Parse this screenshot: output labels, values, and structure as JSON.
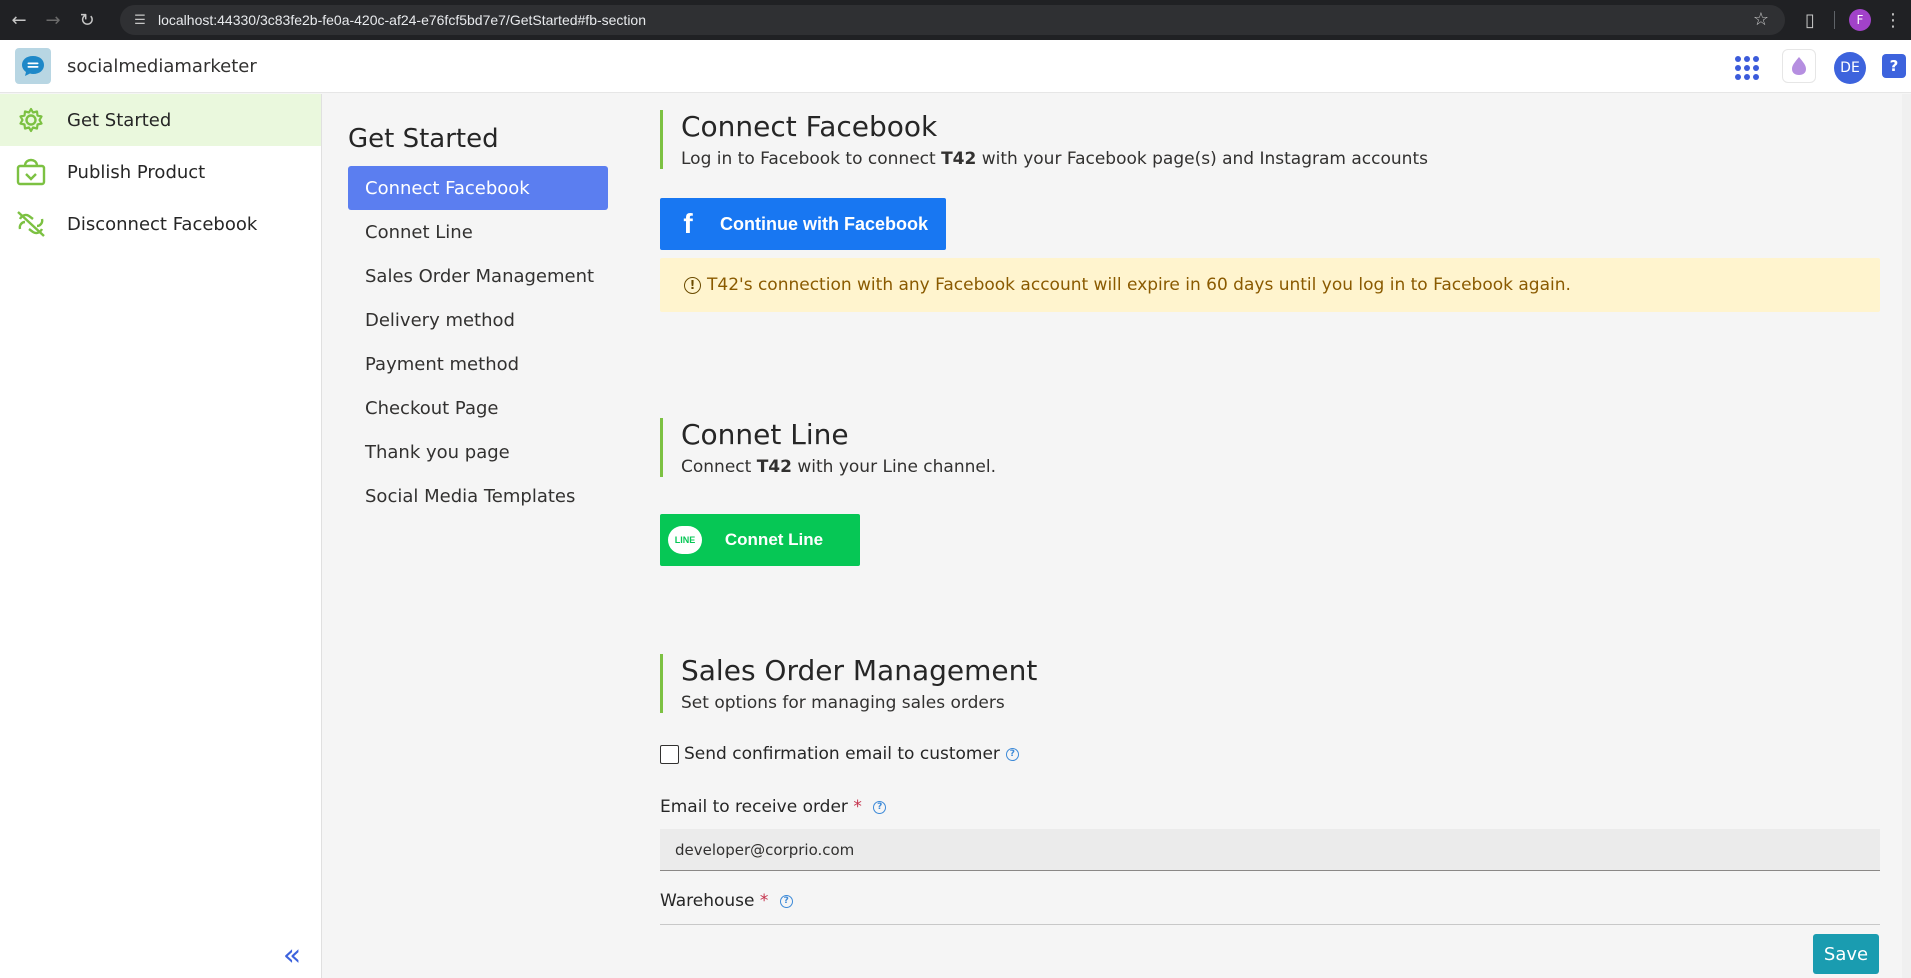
{
  "browser": {
    "url": "localhost:44330/3c83fe2b-fe0a-420c-af24-e76fcf5bd7e7/GetStarted#fb-section",
    "profile_initial": "F"
  },
  "app": {
    "name": "socialmediamarketer",
    "user_initials": "DE",
    "help_label": "?"
  },
  "leftnav": {
    "items": [
      {
        "label": "Get Started",
        "icon": "gear-icon",
        "active": true
      },
      {
        "label": "Publish Product",
        "icon": "publish-bag-icon",
        "active": false
      },
      {
        "label": "Disconnect Facebook",
        "icon": "unlink-icon",
        "active": false
      }
    ],
    "accent_color": "#7cc142"
  },
  "secnav": {
    "title": "Get Started",
    "items": [
      {
        "label": "Connect Facebook",
        "active": true
      },
      {
        "label": "Connet Line",
        "active": false
      },
      {
        "label": "Sales Order Management",
        "active": false
      },
      {
        "label": "Delivery method",
        "active": false
      },
      {
        "label": "Payment method",
        "active": false
      },
      {
        "label": "Checkout Page",
        "active": false
      },
      {
        "label": "Thank you page",
        "active": false
      },
      {
        "label": "Social Media Templates",
        "active": false
      }
    ]
  },
  "facebook": {
    "title": "Connect Facebook",
    "desc_pre": "Log in to Facebook to connect ",
    "desc_bold": "T42",
    "desc_post": " with your Facebook page(s) and Instagram accounts",
    "button_label": "Continue with Facebook",
    "button_color": "#1877f2",
    "warning": "T42's connection with any Facebook account will expire in 60 days until you log in to Facebook again."
  },
  "line": {
    "title": "Connet Line",
    "desc_pre": "Connect ",
    "desc_bold": "T42",
    "desc_post": " with your Line channel.",
    "button_label": "Connet Line",
    "logo_text": "LINE",
    "button_color": "#06c755"
  },
  "sales": {
    "title": "Sales Order Management",
    "desc": "Set options for managing sales orders",
    "checkbox_label": "Send confirmation email to customer",
    "checkbox_checked": false,
    "email_label": "Email to receive order",
    "email_value": "developer@corprio.com",
    "warehouse_label": "Warehouse",
    "required_mark": "*"
  },
  "save_label": "Save",
  "save_color": "#1a9cb0"
}
